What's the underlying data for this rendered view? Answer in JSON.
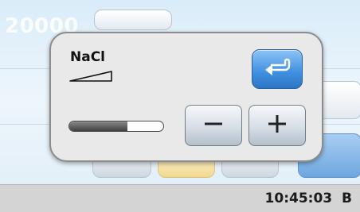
{
  "background": {
    "value": "20000"
  },
  "dialog": {
    "title": "NaCl",
    "level_fraction": 0.62,
    "icons": {
      "ramp": "ramp-icon",
      "return": "return-arrow-icon",
      "minus": "minus-icon",
      "plus": "plus-icon"
    }
  },
  "status_bar": {
    "time": "10:45:03",
    "suffix": "B"
  },
  "colors": {
    "accent": "#3f8fe0",
    "panel": "#e9e9e9",
    "status_bar": "#d4d4d4"
  }
}
